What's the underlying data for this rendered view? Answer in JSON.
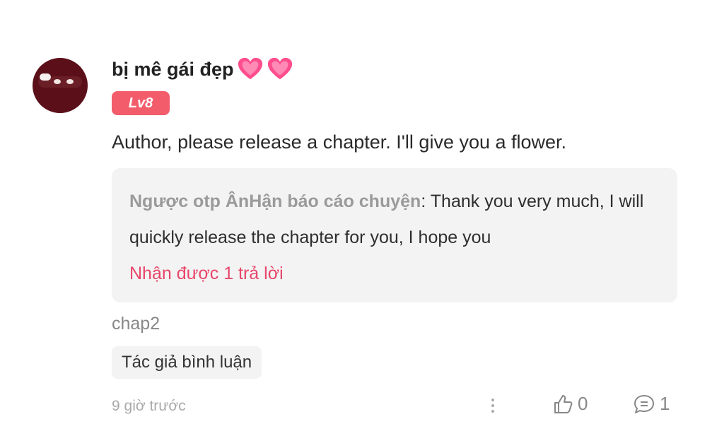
{
  "comment": {
    "username": "bị mê gái đẹp",
    "username_emoji_icons": [
      "heart-icon",
      "heart-icon"
    ],
    "level": "Lv8",
    "text": "Author, please release a chapter. I'll give you a flower.",
    "reply": {
      "author": "Ngược otp ÂnHận báo cáo chuyện",
      "separator": ": ",
      "text": "Thank you very much, I will quickly release the chapter for you, I hope you",
      "count_label": "Nhận được 1 trả lời"
    },
    "tag": "chap2",
    "author_chip": "Tác giả bình luận",
    "timestamp": "9 giờ trước",
    "likes": "0",
    "replies": "1"
  },
  "colors": {
    "level_badge": "#f25c6b",
    "reply_link": "#e8466a",
    "heart": "#ff4d8d",
    "avatar": "#5b1019"
  }
}
